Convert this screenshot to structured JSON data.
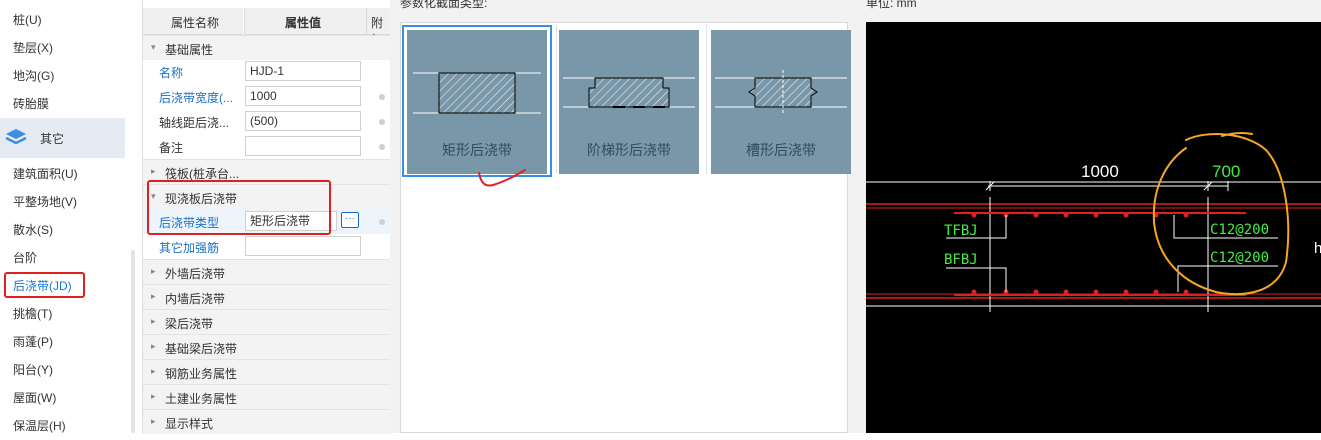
{
  "nav": {
    "items_top": [
      "桩(U)",
      "垫层(X)",
      "地沟(G)",
      "砖胎膜"
    ],
    "group_label": "其它",
    "items_bottom": [
      "建筑面积(U)",
      "平整场地(V)",
      "散水(S)",
      "台阶",
      "后浇带(JD)",
      "挑檐(T)",
      "雨蓬(P)",
      "阳台(Y)",
      "屋面(W)",
      "保温层(H)"
    ]
  },
  "props": {
    "col_name": "属性名称",
    "col_value": "属性值",
    "col_extra": "附加",
    "group_basic": "基础属性",
    "rows_basic": [
      {
        "label": "名称",
        "value": "HJD-1"
      },
      {
        "label": "后浇带宽度(...",
        "value": "1000"
      },
      {
        "label": "轴线距后浇...",
        "value": "(500)"
      },
      {
        "label": "备注",
        "value": ""
      }
    ],
    "group_raft": "筏板(桩承台...",
    "group_cast": "现浇板后浇带",
    "type_label": "后浇带类型",
    "type_value": "矩形后浇带",
    "type_button": "···",
    "other_rebar": "其它加强筋",
    "groups_more": [
      "外墙后浇带",
      "内墙后浇带",
      "梁后浇带",
      "基础梁后浇带",
      "钢筋业务属性",
      "土建业务属性",
      "显示样式"
    ]
  },
  "dialog": {
    "types_header": "参数化截面类型:",
    "unit_header": "单位: mm",
    "tiles": [
      "矩形后浇带",
      "阶梯形后浇带",
      "槽形后浇带"
    ]
  },
  "cad": {
    "dim_width": "1000",
    "dim_700": "700",
    "top_label": "TFBJ",
    "bottom_label": "BFBJ",
    "rebar_top": "C12@200",
    "rebar_bottom": "C12@200",
    "side_letter": "h"
  },
  "colors": {
    "accent_blue": "#1a6fc6",
    "highlight_red": "#e02020",
    "annotation_orange": "#f5a623",
    "tile_bg": "#7997a9"
  }
}
